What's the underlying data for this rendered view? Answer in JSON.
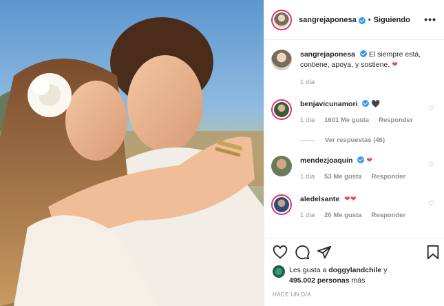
{
  "post": {
    "author": "sangrejaponesa",
    "follow_label": "Siguiendo",
    "separator": "•",
    "more_label": "•••",
    "caption": "El siempre está, contiene, apoya, y sostiene.",
    "caption_emoji": "❤",
    "caption_time": "1 día"
  },
  "comments": [
    {
      "username": "benjavicunamori",
      "verified": true,
      "text": "🖤",
      "time": "1 día",
      "likes": "1601 Me gusta",
      "reply_label": "Responder"
    },
    {
      "username": "mendezjoaquin",
      "verified": true,
      "text": "❤",
      "time": "1 día",
      "likes": "53 Me gusta",
      "reply_label": "Responder"
    },
    {
      "username": "aledelsante",
      "verified": false,
      "text": "❤❤",
      "time": "1 día",
      "likes": "20 Me gusta",
      "reply_label": "Responder"
    }
  ],
  "view_replies": "Ver respuestas (46)",
  "likes": {
    "prefix": "Les gusta a ",
    "user": "doggylandchile",
    "middle": " y",
    "count": "495.002 personas",
    "suffix": " más"
  },
  "date": "HACE UN DÍA",
  "icons": [
    "heart-icon",
    "comment-icon",
    "share-icon",
    "bookmark-icon",
    "more-icon",
    "verified-icon"
  ],
  "colors": {
    "accent": "#3897f0",
    "like_red": "#ed4956",
    "story_ring": "#e1306c"
  }
}
